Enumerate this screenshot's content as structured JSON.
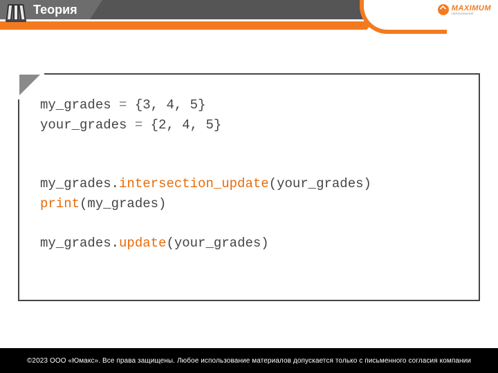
{
  "header": {
    "title": "Теория",
    "logo": {
      "brand": "MAXIMUM",
      "tagline": "ОБРАЗОВАНИЕ"
    }
  },
  "code": {
    "l1_var": "my_grades",
    "l1_op": " = ",
    "l1_val": "{3, 4, 5}",
    "l2_var": "your_grades",
    "l2_op": " = ",
    "l2_val": "{2, 4, 5}",
    "l3_obj": "my_grades",
    "l3_dot": ".",
    "l3_method": "intersection_update",
    "l3_args": "(your_grades)",
    "l4_fn": "print",
    "l4_args": "(my_grades)",
    "l5_obj": "my_grades",
    "l5_dot": ".",
    "l5_method": "update",
    "l5_args": "(your_grades)"
  },
  "footer": {
    "copyright": "©2023 ООО «Юмакс». Все права защищены. Любое использование материалов допускается только с письменного согласия компании"
  }
}
